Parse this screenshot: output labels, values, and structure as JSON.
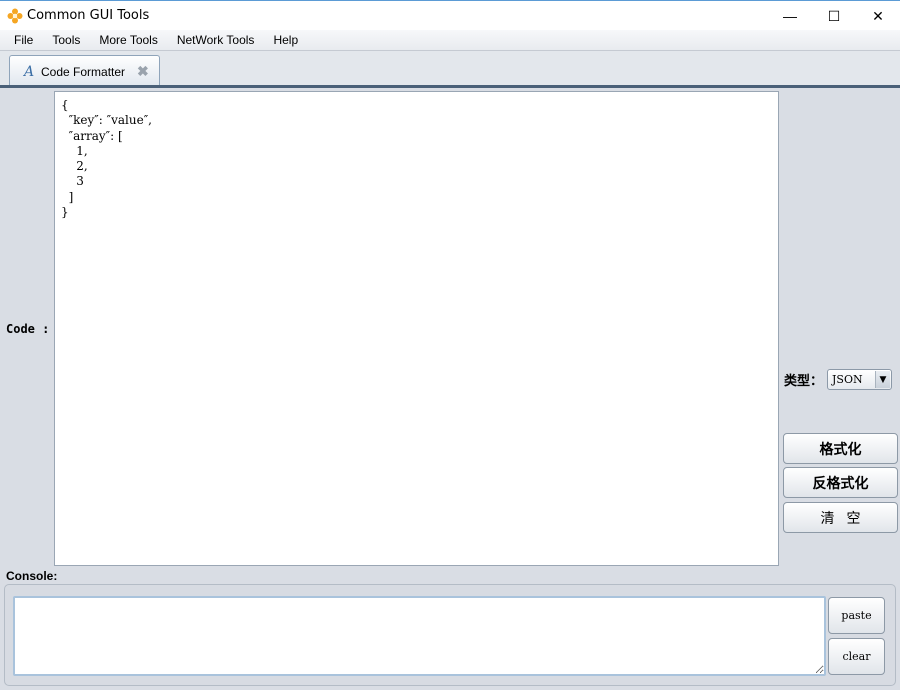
{
  "window": {
    "title": "Common GUI Tools",
    "minimize_glyph": "—",
    "maximize_glyph": "☐",
    "close_glyph": "✕",
    "icon": "app-flower-icon",
    "accent": "#f5a623"
  },
  "menu": [
    "File",
    "Tools",
    "More Tools",
    "NetWork Tools",
    "Help"
  ],
  "tabs": [
    {
      "label": "Code Formatter",
      "icon_glyph": "A",
      "close_glyph": "✖"
    }
  ],
  "editor": {
    "label": "Code :",
    "content": "{\n  ″key″: ″value″,\n  ″array″: [\n    1,\n    2,\n    3\n  ]\n}"
  },
  "type_selector": {
    "label": "类型：",
    "value": "JSON",
    "arrow_glyph": "▼"
  },
  "actions": {
    "format": "格式化",
    "unformat": "反格式化",
    "clear": "清空"
  },
  "console": {
    "label": "Console:",
    "content": "",
    "paste": "paste",
    "clear": "clear"
  }
}
